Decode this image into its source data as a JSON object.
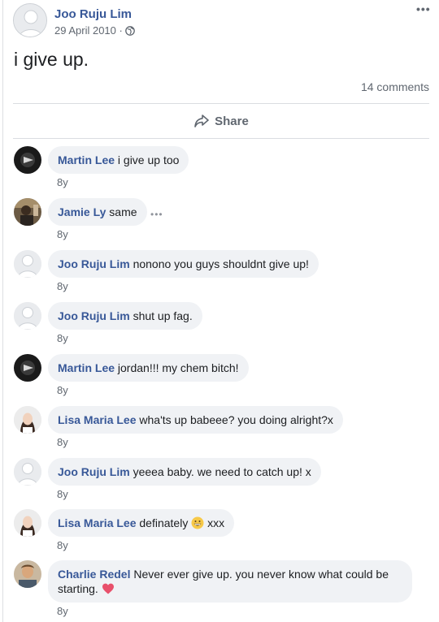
{
  "post": {
    "author": "Joo Ruju Lim",
    "date": "29 April 2010 ·",
    "text": "i give up.",
    "comment_count": "14 comments",
    "share_label": "Share",
    "more_label": "•••"
  },
  "comments": [
    {
      "name": "Martin Lee",
      "text": "i give up too",
      "time": "8y",
      "avatar": "dark-photo"
    },
    {
      "name": "Jamie Ly",
      "text": "same",
      "time": "8y",
      "avatar": "photo",
      "more": "•••"
    },
    {
      "name": "Joo Ruju Lim",
      "text": "nonono you guys shouldnt give up!",
      "time": "8y",
      "avatar": "default"
    },
    {
      "name": "Joo Ruju Lim",
      "text": "shut up fag.",
      "time": "8y",
      "avatar": "default"
    },
    {
      "name": "Martin Lee",
      "text": "jordan!!! my chem bitch!",
      "time": "8y",
      "avatar": "dark-photo"
    },
    {
      "name": "Lisa Maria Lee",
      "text": "wha'ts up babeee? you doing alright?x",
      "time": "8y",
      "avatar": "photo"
    },
    {
      "name": "Joo Ruju Lim",
      "text": "yeeea baby. we need to catch up! x",
      "time": "8y",
      "avatar": "default"
    },
    {
      "name": "Lisa Maria Lee",
      "text_before": "definately",
      "text_after": "xxx",
      "time": "8y",
      "avatar": "photo",
      "emoji": "grinning-face"
    },
    {
      "name": "Charlie Redel",
      "text": "Never ever give up. you never know what could be starting.",
      "time": "8y",
      "avatar": "photo",
      "emoji": "red-heart"
    }
  ],
  "colors": {
    "link": "#385898",
    "bubble": "#f0f2f5",
    "muted": "#606770",
    "heart": "#e8506b",
    "emoji_face": "#f7c948"
  }
}
